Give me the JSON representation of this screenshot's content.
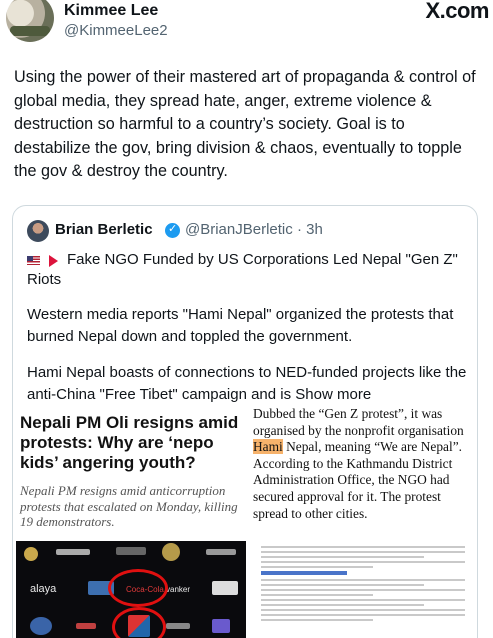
{
  "post": {
    "author_name": "Kimmee Lee",
    "author_handle": "@KimmeeLee2",
    "brand": "X.com",
    "text": "Using the power of their mastered art of propaganda & control of global media, they spread hate, anger, extreme violence & destruction so harmful to a country’s society. Goal is to destabilize the gov, bring division & chaos, eventually to topple the gov & destroy the country."
  },
  "quote": {
    "author_name": "Brian Berletic",
    "author_handle": "@BrianJBerletic",
    "time": "· 3h",
    "title": "Fake NGO Funded by US Corporations Led Nepal \"Gen Z\" Riots",
    "para1": "Western media reports \"Hami Nepal\" organized the protests that burned Nepal down and toppled the government.",
    "para2": "Hami Nepal boasts of connections to NED-funded projects like the anti-China \"Free Tibet\" campaign and is",
    "show_more": "Show more",
    "icons": [
      "us-flag-icon",
      "nepal-flag-icon",
      "verified-badge-icon"
    ]
  },
  "article_left": {
    "headline": "Nepali PM Oli resigns amid protests: Why are ‘nepo kids’ angering youth?",
    "subhead": "Nepali PM resigns amid anticorruption protests that escalated on Monday, killing 19 demonstrators.",
    "photo_labels": {
      "brand1": "alaya",
      "brand2": "Coca-Cola",
      "brand3": "vanker"
    }
  },
  "article_right": {
    "text_before": "Dubbed the “Gen Z protest”, it was organised by the nonprofit organisation ",
    "highlight": "Hami",
    "text_after": " Nepal, meaning “We are Nepal”. According to the Kathmandu District Administration Office, the NGO had secured approval for it. The protest spread to other cities."
  },
  "colors": {
    "text": "#0f1419",
    "muted": "#536471",
    "verified": "#1d9bf0",
    "highlight": "#f6b26b",
    "circle": "#e01010"
  }
}
